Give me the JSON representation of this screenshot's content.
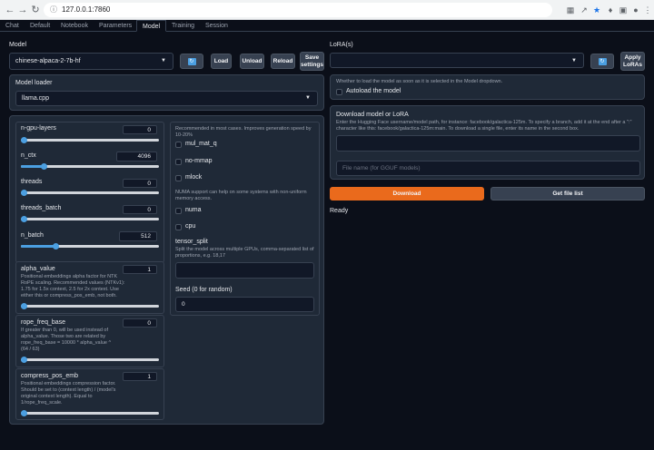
{
  "browser": {
    "url": "127.0.0.1:7860",
    "back_icon": "back-arrow-icon",
    "forward_icon": "forward-arrow-icon",
    "reload_icon": "reload-icon"
  },
  "tabs": [
    "Chat",
    "Default",
    "Notebook",
    "Parameters",
    "Model",
    "Training",
    "Session"
  ],
  "active_tab": "Model",
  "model": {
    "label": "Model",
    "selected": "chinese-alpaca-2-7b-hf",
    "load": "Load",
    "unload": "Unload",
    "reload": "Reload",
    "save_settings_1": "Save",
    "save_settings_2": "settings"
  },
  "lora": {
    "label": "LoRA(s)",
    "apply_1": "Apply",
    "apply_2": "LoRAs"
  },
  "loader": {
    "label": "Model loader",
    "selected": "llama.cpp"
  },
  "sliders": {
    "n_gpu_layers": {
      "label": "n-gpu-layers",
      "value": "0",
      "fraction": 0.0
    },
    "n_ctx": {
      "label": "n_ctx",
      "value": "4096",
      "fraction": 0.17
    },
    "threads": {
      "label": "threads",
      "value": "0",
      "fraction": 0.0
    },
    "threads_batch": {
      "label": "threads_batch",
      "value": "0",
      "fraction": 0.0
    },
    "n_batch": {
      "label": "n_batch",
      "value": "512",
      "fraction": 0.25
    }
  },
  "alpha": {
    "label": "alpha_value",
    "value": "1",
    "info_1": "Positional embeddings alpha factor for NTK",
    "info_2": "RoPE scaling. Recommended values (NTKv1):",
    "info_3": "1.75 for 1.5x context, 2.5 for 2x context. Use",
    "info_4": "either this or compress_pos_emb, not both.",
    "fraction": 0.0
  },
  "rope": {
    "label": "rope_freq_base",
    "value": "0",
    "info_1": "If greater than 0, will be used instead of",
    "info_2": "alpha_value. Those two are related by",
    "info_3": "rope_freq_base = 10000 * alpha_value ^",
    "info_4": "(64 / 63)",
    "fraction": 0.0
  },
  "compress": {
    "label": "compress_pos_emb",
    "value": "1",
    "info_1": "Positional embeddings compression factor.",
    "info_2": "Should be set to (context length) / (model's",
    "info_3": "original context length). Equal to",
    "info_4": "1/rope_freq_scale.",
    "fraction": 0.0
  },
  "options": {
    "rec_1": "Recommended in most cases. Improves generation speed by",
    "rec_2": "10-20%",
    "mul_mat_q": "mul_mat_q",
    "no_mmap": "no-mmap",
    "mlock": "mlock",
    "numa_1": "NUMA support can help on some systems with non-uniform",
    "numa_2": "memory access.",
    "numa": "numa",
    "cpu": "cpu",
    "tensor_split": "tensor_split",
    "tensor_info_1": "Split the model across multiple GPUs, comma-separated list of",
    "tensor_info_2": "proportions, e.g. 18,17",
    "seed_label": "Seed (0 for random)",
    "seed_value": "0"
  },
  "autoload": {
    "info": "Whether to load the model as soon as it is selected in the Model dropdown.",
    "label": "Autoload the model"
  },
  "download": {
    "title": "Download model or LoRA",
    "info_1": "Enter the Hugging Face username/model path, for instance: facebook/galactica-125m. To specify a branch, add it at the end after a \":\"",
    "info_2": "character like this: facebook/galactica-125m:main. To download a single file, enter its name in the second box.",
    "file_placeholder": "File name (for GGUF models)",
    "download_btn": "Download",
    "get_file_list": "Get file list",
    "status": "Ready"
  },
  "colors": {
    "background": "#0b0f19",
    "panel": "#1f2937",
    "accent_orange": "#ea6a1c",
    "slider_blue": "#4b9fe1"
  }
}
